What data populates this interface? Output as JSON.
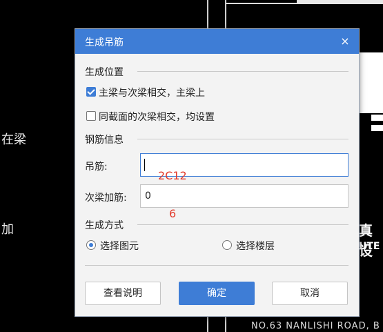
{
  "background": {
    "left_texts": [
      "在梁",
      "加"
    ],
    "right_texts": [
      "真设",
      "UTE"
    ],
    "bottom_text": "NO.63 NANLISHI ROAD, B"
  },
  "dialog": {
    "title": "生成吊筋",
    "close_label": "×",
    "section_position": "生成位置",
    "option_main_secondary": {
      "label": "主梁与次梁相交，主梁上",
      "checked": true
    },
    "option_same_section": {
      "label": "同截面的次梁相交，均设置",
      "checked": false
    },
    "section_rebar": "钢筋信息",
    "hanger_label": "吊筋:",
    "hanger_value": "",
    "secondary_rebar_label": "次梁加筋:",
    "secondary_rebar_value": "0",
    "overlay_hanger": "2C12",
    "overlay_secondary": "6",
    "section_method": "生成方式",
    "radio_select_element": {
      "label": "选择图元",
      "selected": true
    },
    "radio_select_floor": {
      "label": "选择楼层",
      "selected": false
    },
    "btn_help": "查看说明",
    "btn_ok": "确定",
    "btn_cancel": "取消"
  },
  "colors": {
    "accent": "#3e7dd6",
    "annotation": "#e23a2b"
  }
}
